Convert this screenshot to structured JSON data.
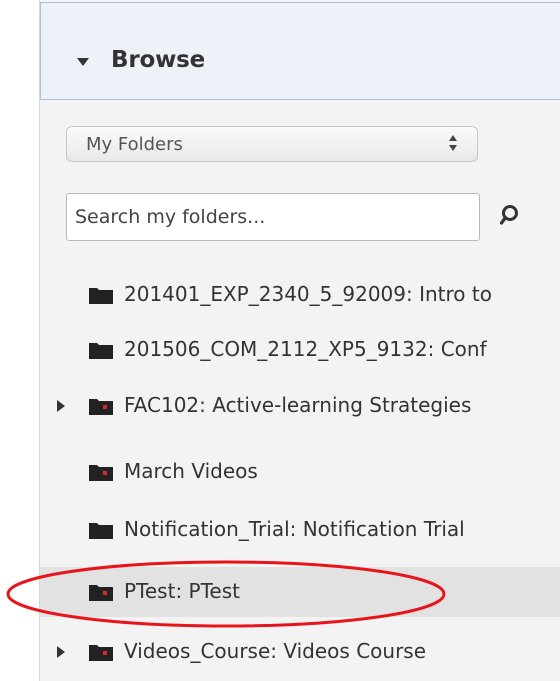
{
  "browse_panel": {
    "title": "Browse",
    "folder_selector": {
      "selected": "My Folders"
    },
    "search": {
      "placeholder": "Search my folders..."
    },
    "folders": [
      {
        "label": "201401_EXP_2340_5_92009: Intro to",
        "expandable": false,
        "selected": false,
        "shared": false
      },
      {
        "label": "201506_COM_2112_XP5_9132: Conf",
        "expandable": false,
        "selected": false,
        "shared": false
      },
      {
        "label": "FAC102: Active-learning Strategies",
        "expandable": true,
        "selected": false,
        "shared": true
      },
      {
        "label": "March Videos",
        "expandable": false,
        "selected": false,
        "shared": true
      },
      {
        "label": "Notification_Trial: Notification Trial",
        "expandable": false,
        "selected": false,
        "shared": false
      },
      {
        "label": "PTest: PTest",
        "expandable": false,
        "selected": true,
        "shared": true
      },
      {
        "label": "Videos_Course: Videos Course",
        "expandable": true,
        "selected": false,
        "shared": true
      }
    ]
  },
  "annotation": {
    "color": "#e8141c"
  },
  "colors": {
    "header_bg": "#eef2f8",
    "header_border": "#a8c0de",
    "panel_bg": "#f3f3f3",
    "selected_row_bg": "#e2e2e2",
    "shared_badge": "#e0262b"
  }
}
